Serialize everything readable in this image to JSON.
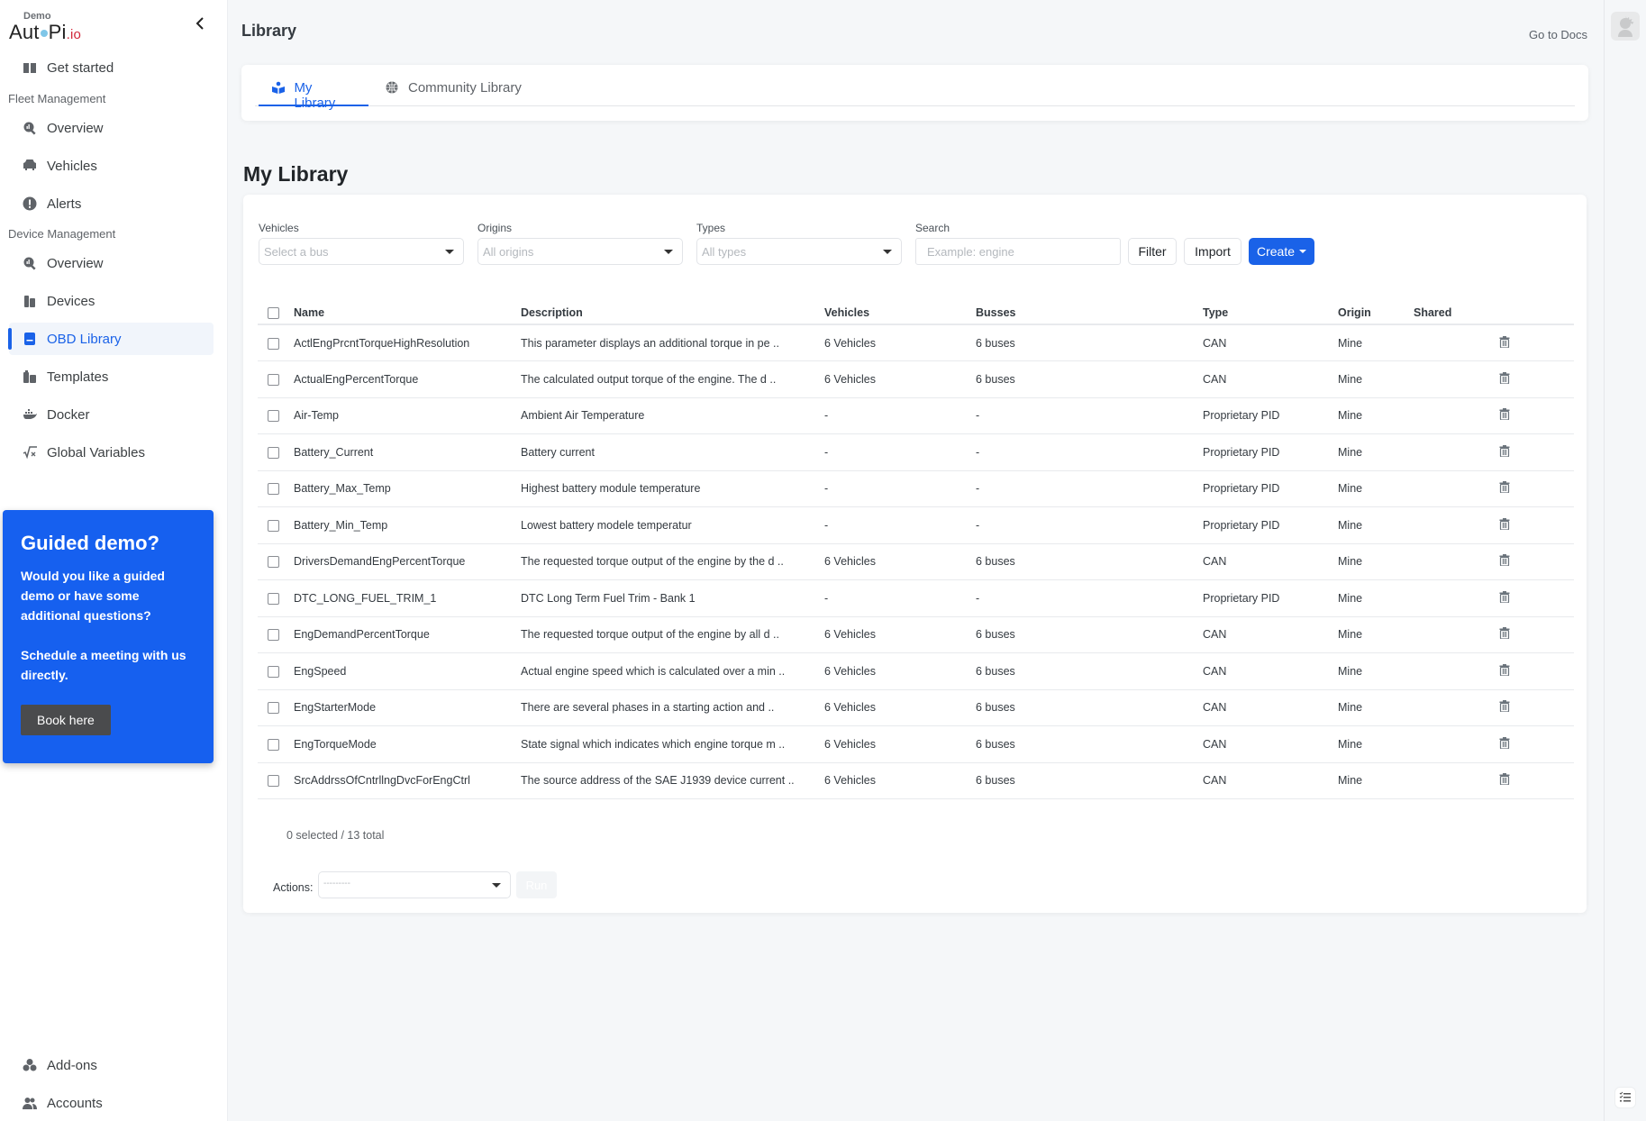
{
  "app": {
    "logo_badge": "Demo",
    "logo_text": "AutoPi",
    "logo_suffix": ".io"
  },
  "sidebar": {
    "get_started": "Get started",
    "sections": [
      {
        "title": "Fleet Management",
        "items": [
          "Overview",
          "Vehicles",
          "Alerts"
        ]
      },
      {
        "title": "Device Management",
        "items": [
          "Overview",
          "Devices",
          "OBD Library",
          "Templates",
          "Docker",
          "Global Variables"
        ]
      }
    ],
    "active_item": "OBD Library",
    "bottom_items": [
      "Add-ons",
      "Accounts"
    ]
  },
  "promo": {
    "title": "Guided demo?",
    "text1": "Would you like a guided demo or have some additional questions?",
    "text2": "Schedule a meeting with us directly.",
    "button": "Book here"
  },
  "header": {
    "title": "Library",
    "docs_link": "Go to Docs"
  },
  "tabs": [
    {
      "label": "My Library",
      "active": true
    },
    {
      "label": "Community Library",
      "active": false
    }
  ],
  "section_title": "My Library",
  "filters": {
    "vehicles": {
      "label": "Vehicles",
      "placeholder": "Select a bus"
    },
    "origins": {
      "label": "Origins",
      "placeholder": "All origins"
    },
    "types": {
      "label": "Types",
      "placeholder": "All types"
    },
    "search": {
      "label": "Search",
      "placeholder": "Example: engine",
      "value": ""
    },
    "filter_button": "Filter",
    "import_button": "Import",
    "create_button": "Create"
  },
  "table": {
    "columns": [
      "Name",
      "Description",
      "Vehicles",
      "Busses",
      "Type",
      "Origin",
      "Shared"
    ],
    "rows": [
      {
        "name": "ActlEngPrcntTorqueHighResolution",
        "description": "This parameter displays an additional torque in pe ..",
        "vehicles": "6 Vehicles",
        "busses": "6 buses",
        "type": "CAN",
        "origin": "Mine",
        "shared": ""
      },
      {
        "name": "ActualEngPercentTorque",
        "description": "The calculated output torque of the engine. The d ..",
        "vehicles": "6 Vehicles",
        "busses": "6 buses",
        "type": "CAN",
        "origin": "Mine",
        "shared": ""
      },
      {
        "name": "Air-Temp",
        "description": "Ambient Air Temperature",
        "vehicles": "-",
        "busses": "-",
        "type": "Proprietary PID",
        "origin": "Mine",
        "shared": ""
      },
      {
        "name": "Battery_Current",
        "description": "Battery current",
        "vehicles": "-",
        "busses": "-",
        "type": "Proprietary PID",
        "origin": "Mine",
        "shared": ""
      },
      {
        "name": "Battery_Max_Temp",
        "description": "Highest battery module temperature",
        "vehicles": "-",
        "busses": "-",
        "type": "Proprietary PID",
        "origin": "Mine",
        "shared": ""
      },
      {
        "name": "Battery_Min_Temp",
        "description": "Lowest battery modele temperatur",
        "vehicles": "-",
        "busses": "-",
        "type": "Proprietary PID",
        "origin": "Mine",
        "shared": ""
      },
      {
        "name": "DriversDemandEngPercentTorque",
        "description": "The requested torque output of the engine by the d ..",
        "vehicles": "6 Vehicles",
        "busses": "6 buses",
        "type": "CAN",
        "origin": "Mine",
        "shared": ""
      },
      {
        "name": "DTC_LONG_FUEL_TRIM_1",
        "description": "DTC Long Term Fuel Trim - Bank 1",
        "vehicles": "-",
        "busses": "-",
        "type": "Proprietary PID",
        "origin": "Mine",
        "shared": ""
      },
      {
        "name": "EngDemandPercentTorque",
        "description": "The requested torque output of the engine by all d ..",
        "vehicles": "6 Vehicles",
        "busses": "6 buses",
        "type": "CAN",
        "origin": "Mine",
        "shared": ""
      },
      {
        "name": "EngSpeed",
        "description": "Actual engine speed which is calculated over a min ..",
        "vehicles": "6 Vehicles",
        "busses": "6 buses",
        "type": "CAN",
        "origin": "Mine",
        "shared": ""
      },
      {
        "name": "EngStarterMode",
        "description": "There are several phases in a starting action and ..",
        "vehicles": "6 Vehicles",
        "busses": "6 buses",
        "type": "CAN",
        "origin": "Mine",
        "shared": ""
      },
      {
        "name": "EngTorqueMode",
        "description": "State signal which indicates which engine torque m ..",
        "vehicles": "6 Vehicles",
        "busses": "6 buses",
        "type": "CAN",
        "origin": "Mine",
        "shared": ""
      },
      {
        "name": "SrcAddrssOfCntrllngDvcForEngCtrl",
        "description": "The source address of the SAE J1939 device current ..",
        "vehicles": "6 Vehicles",
        "busses": "6 buses",
        "type": "CAN",
        "origin": "Mine",
        "shared": ""
      }
    ]
  },
  "footer": {
    "selection_count": "0 selected / 13 total",
    "actions_label": "Actions:",
    "actions_placeholder": "---------",
    "run_button": "Run"
  },
  "colors": {
    "accent": "#1a62e8",
    "promo_bg": "#1660ef",
    "logo_io": "#d0263a"
  }
}
